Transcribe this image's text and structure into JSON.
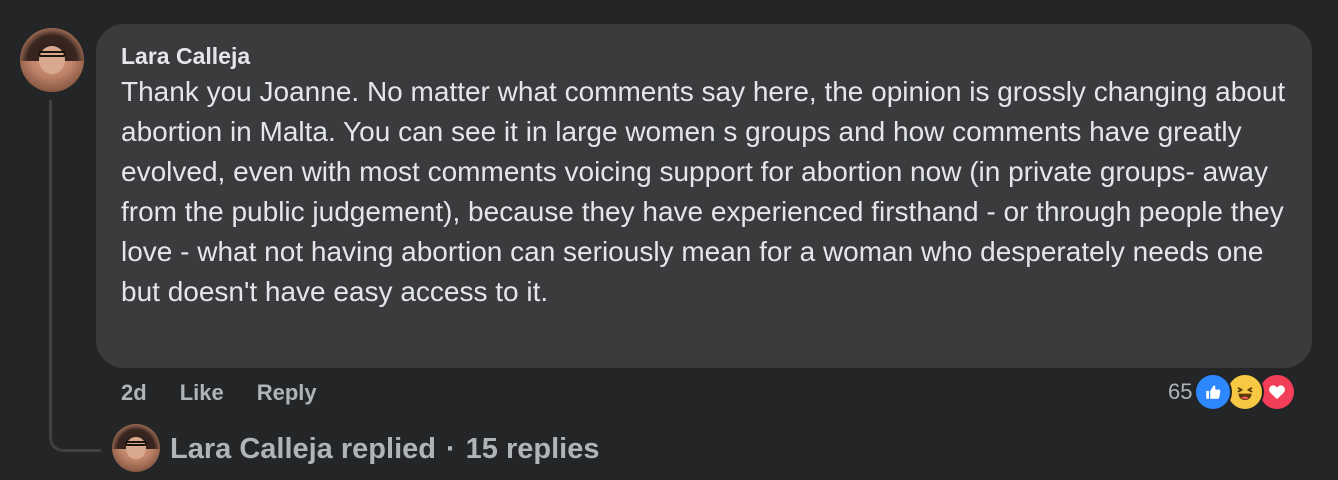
{
  "comment": {
    "author": "Lara Calleja",
    "text": "Thank you Joanne. No matter what comments say here, the opinion is grossly changing about abortion in Malta. You can see it in large women s groups and how comments have greatly evolved, even with most comments voicing support for abortion now (in private groups- away from the public judgement), because they have experienced firsthand - or through people they love - what not having abortion can seriously mean for a woman who desperately needs one but doesn't have easy access to it.",
    "timestamp": "2d",
    "like_label": "Like",
    "reply_label": "Reply",
    "reaction_count": "65",
    "reactions": [
      "like-icon",
      "haha-icon",
      "love-icon"
    ]
  },
  "replies": {
    "author": "Lara Calleja",
    "action": "replied",
    "separator": "·",
    "count_label": "15 replies"
  },
  "colors": {
    "background": "#242526",
    "bubble": "#3a3b3c",
    "text_primary": "#e4e6eb",
    "text_secondary": "#b0b3b8",
    "like_blue": "#2d88ff",
    "haha_yellow": "#f7c843",
    "love_red": "#f33e58"
  }
}
